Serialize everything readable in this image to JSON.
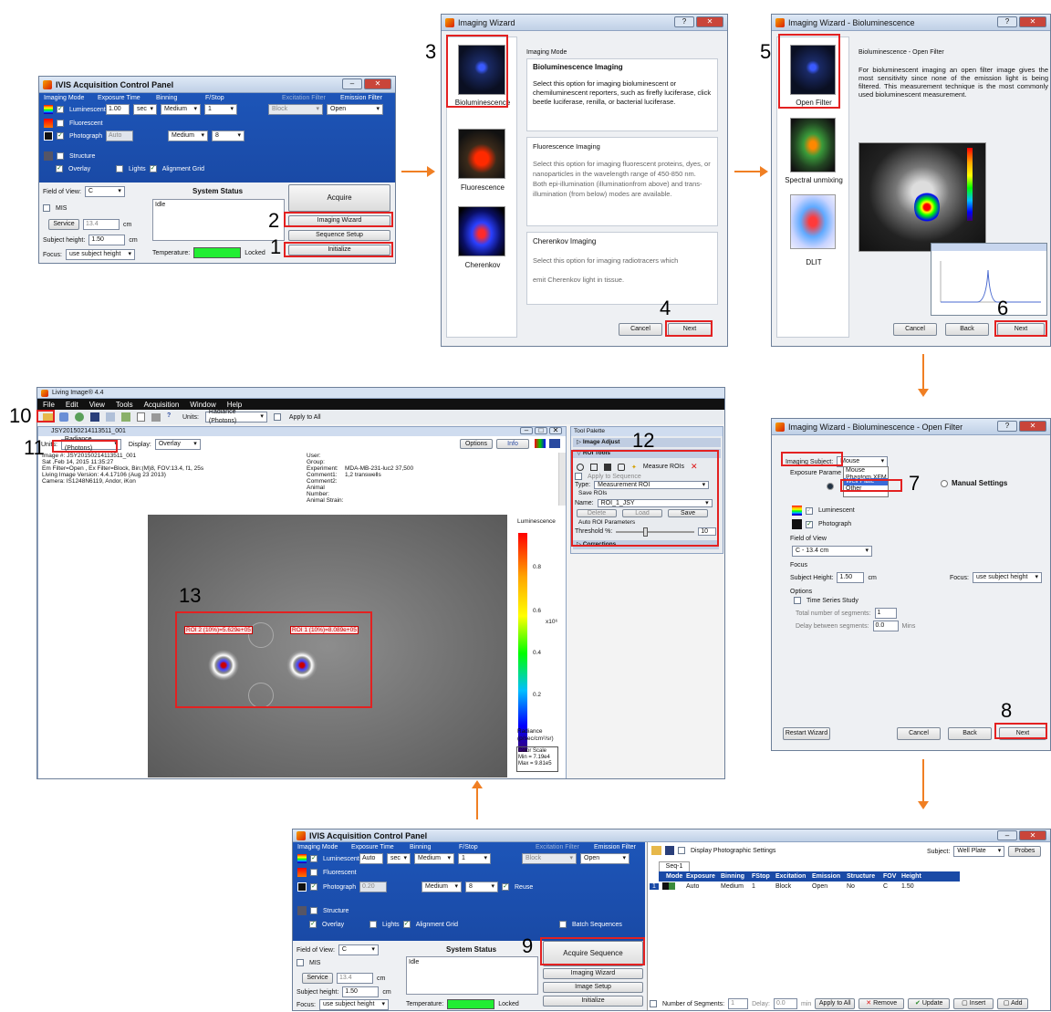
{
  "step_numbers": [
    "1",
    "2",
    "3",
    "4",
    "5",
    "6",
    "7",
    "8",
    "9",
    "10",
    "11",
    "12",
    "13"
  ],
  "acq1": {
    "title": "IVIS Acquisition Control Panel",
    "col_headers": [
      "Imaging Mode",
      "Exposure Time",
      "Binning",
      "F/Stop",
      "Excitation Filter",
      "Emission Filter"
    ],
    "luminescent": {
      "label": "Luminescent",
      "exposure": "1.00",
      "unit": "sec",
      "binning": "Medium",
      "fstop": "1",
      "excitation": "Block",
      "emission": "Open"
    },
    "fluorescent": {
      "label": "Fluorescent"
    },
    "photograph": {
      "label": "Photograph",
      "exposure": "Auto",
      "binning": "Medium",
      "fstop": "8"
    },
    "structure": {
      "label": "Structure"
    },
    "overlay": "Overlay",
    "lights": "Lights",
    "alignment_grid": "Alignment Grid",
    "fov_label": "Field of View:",
    "fov_value": "C",
    "mis": "MIS",
    "service": "Service",
    "service_val": "13.4",
    "cm": "cm",
    "subject_height_label": "Subject height:",
    "subject_height_val": "1.50",
    "focus_label": "Focus:",
    "focus_val": "use subject height",
    "system_status": "System Status",
    "status_val": "Idle",
    "temperature": "Temperature:",
    "locked": "Locked",
    "acquire": "Acquire",
    "imaging_wizard": "Imaging Wizard",
    "sequence_setup": "Sequence Setup",
    "initialize": "Initialize"
  },
  "wiz1": {
    "title": "Imaging Wizard",
    "options": [
      "Bioluminescence",
      "Fluorescence",
      "Cherenkov"
    ],
    "imaging_mode": "Imaging Mode",
    "bio_h": "Bioluminescence Imaging",
    "bio_t": "Select this option for imaging bioluminescent or chemiluminescent reporters, such as firefly luciferase, click beetle luciferase, renilla, or bacterial luciferase.",
    "fluo_h": "Fluorescence Imaging",
    "fluo_t": "Select this option for imaging fluorescent proteins, dyes, or nanoparticles in the wavelength range of 450-850 nm.",
    "fluo_t2": "Both epi-illumination (illuminationfrom above) and trans-illumination (from below) modes are available.",
    "cher_h": "Cherenkov Imaging",
    "cher_t": "Select this option for imaging radiotracers which",
    "cher_t2": "emit Cherenkov light in tissue.",
    "cancel": "Cancel",
    "next": "Next"
  },
  "wiz2": {
    "title": "Imaging Wizard - Bioluminescence",
    "options": [
      "Open Filter",
      "Spectral unmixing",
      "DLIT"
    ],
    "heading": "Bioluminescence - Open Filter",
    "text": "For bioluminescent imaging an open filter image gives the most sensitivity since none of the emission light is being filtered.  This measurement technique is the most commonly used bioluminescent measurement.",
    "cancel": "Cancel",
    "back": "Back",
    "next": "Next"
  },
  "wiz3": {
    "title": "Imaging Wizard - Bioluminescence - Open Filter",
    "imaging_subject": "Imaging Subject:",
    "subject_val": "Mouse",
    "dropdown": [
      "Mouse",
      "Phantom XFM",
      "Well Plate",
      "Other"
    ],
    "exposure_params": "Exposure Parame",
    "manual": "Manual Settings",
    "luminescent": "Luminescent",
    "photograph": "Photograph",
    "fov": "Field of View",
    "fov_val": "C - 13.4 cm",
    "focus": "Focus",
    "subject_height": "Subject Height:",
    "height_val": "1.50",
    "cm": "cm",
    "focus_label": "Focus:",
    "focus_val": "use subject height",
    "options": "Options",
    "time_series": "Time Series Study",
    "segments": "Total number of segments:",
    "segments_val": "1",
    "delay": "Delay between segments:",
    "delay_val": "0.0",
    "mins": "Mins",
    "restart": "Restart Wizard",
    "cancel": "Cancel",
    "back": "Back",
    "next": "Next"
  },
  "living": {
    "title": "Living Image® 4.4",
    "menu": [
      "File",
      "Edit",
      "View",
      "Tools",
      "Acquisition",
      "Window",
      "Help"
    ],
    "units_label": "Units:",
    "units_val": "Radiance (Photons)",
    "apply_all": "Apply to All",
    "img_title": "JSY20150214113511_001",
    "display_label": "Display:",
    "display_val": "Overlay",
    "options_btn": "Options",
    "info_btn": "Info",
    "info_left": [
      "Image #: JSY20150214113511_001",
      "Sat ,Feb 14, 2015 11:35:27",
      "Em Filter=Open , Ex Filter=Block, Bin:(M)8, FOV:13.4, f1, 25s",
      "Living Image Version: 4.4.17106 (Aug 23 2013)",
      "Camera: IS1248N6119, Andor, iKon"
    ],
    "info_labels": [
      "User:",
      "Group:",
      "Experiment:",
      "Comment1:",
      "Comment2:",
      "Animal Number:",
      "Animal Strain:"
    ],
    "info_values": [
      "",
      "",
      "MDA-MB-231-luc2 37,500",
      "1,2 transwells",
      "",
      "",
      ""
    ],
    "roi_labels": [
      "ROI 2 (10%)=5.629e+05",
      "ROI 1 (10%)=8.089e+05"
    ],
    "colorbar_title": "Luminescence",
    "ticks": [
      "0.8",
      "0.6",
      "0.4",
      "0.2"
    ],
    "exponent": "x10⁶",
    "radiance": "Radiance",
    "radiance_unit": "(p/sec/cm²/sr)",
    "color_scale": "Color Scale",
    "min": "Min = 7.19e4",
    "max": "Max = 9.81e5",
    "tool_palette": "Tool Palette",
    "image_adjust": "Image Adjust",
    "roi_tools": "ROI Tools",
    "measure_rois": "Measure ROIs",
    "apply_seq": "Apply to Sequence",
    "type_label": "Type:",
    "type_val": "Measurement ROI",
    "save_rois": "Save ROIs",
    "name_label": "Name:",
    "name_val": "ROI_1_JSY",
    "delete": "Delete",
    "load": "Load",
    "save": "Save",
    "auto_roi": "Auto ROI Parameters",
    "threshold": "Threshold %:",
    "threshold_val": "10",
    "corrections": "Corrections"
  },
  "acq2": {
    "title": "IVIS Acquisition Control Panel",
    "col_headers": [
      "Imaging Mode",
      "Exposure Time",
      "Binning",
      "F/Stop",
      "Excitation Filter",
      "Emission Filter"
    ],
    "luminescent": {
      "label": "Luminescent",
      "exposure": "Auto",
      "unit": "sec",
      "binning": "Medium",
      "fstop": "1",
      "excitation": "Block",
      "emission": "Open"
    },
    "fluorescent": {
      "label": "Fluorescent"
    },
    "photograph": {
      "label": "Photograph",
      "exposure": "0.20",
      "binning": "Medium",
      "fstop": "8",
      "reuse": "Reuse"
    },
    "structure": {
      "label": "Structure"
    },
    "overlay": "Overlay",
    "lights": "Lights",
    "alignment_grid": "Alignment Grid",
    "batch": "Batch Sequences",
    "fov_label": "Field of View:",
    "fov_value": "C",
    "mis": "MIS",
    "service": "Service",
    "service_val": "13.4",
    "cm": "cm",
    "subject_height_label": "Subject height:",
    "subject_height_val": "1.50",
    "focus_label": "Focus:",
    "focus_val": "use subject height",
    "system_status": "System Status",
    "status_val": "Idle",
    "temperature": "Temperature:",
    "locked": "Locked",
    "acquire_seq": "Acquire Sequence",
    "imaging_wizard": "Imaging Wizard",
    "image_setup": "Image Setup",
    "initialize": "Initialize",
    "display_photo": "Display Photographic Settings",
    "subject_label": "Subject:",
    "subject_val": "Well Plate",
    "probes": "Probes",
    "seq_tab": "Seq-1",
    "table_headers": [
      "Mode",
      "Exposure",
      "Binning",
      "FStop",
      "Excitation",
      "Emission",
      "Structure",
      "FOV",
      "Height"
    ],
    "table_row": [
      "1",
      "",
      "Auto",
      "Medium",
      "1",
      "Block",
      "Open",
      "No",
      "C",
      "1.50"
    ],
    "num_segments": "Number of Segments:",
    "num_seg_val": "1",
    "delay": "Delay:",
    "delay_val": "0.0",
    "min": "min",
    "apply_all": "Apply to All",
    "remove": "Remove",
    "update": "Update",
    "insert": "Insert",
    "add": "Add"
  }
}
